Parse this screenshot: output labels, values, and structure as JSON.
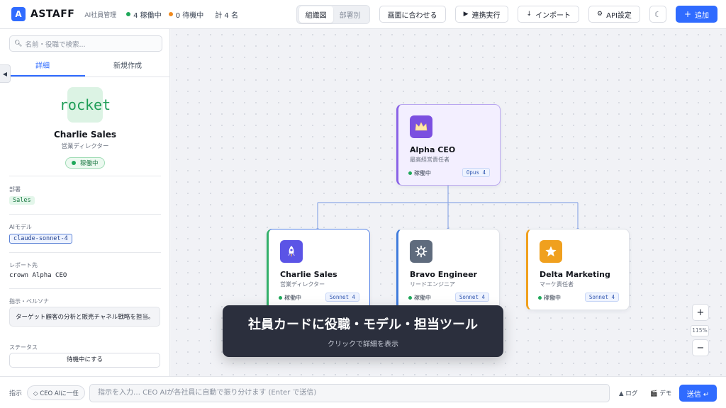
{
  "header": {
    "logo_mark": "A",
    "app_name": "ASTAFF",
    "subtitle": "AI社員管理",
    "stats": [
      {
        "label": "4 稼働中",
        "color": "#1fa85a"
      },
      {
        "label": "0 待機中",
        "color": "#f08a1e"
      },
      {
        "label": "計 4 名"
      }
    ],
    "view_tabs": [
      "組織図",
      "部署別"
    ],
    "fit_button": "画面に合わせる",
    "run_button": "連携実行",
    "import_button": "インポート",
    "api_button": "API設定",
    "add_button": "追加",
    "run_icon": "▶",
    "import_icon": "↓",
    "api_icon": "⚙",
    "theme_icon": "☾",
    "add_icon": "+"
  },
  "sidebar": {
    "collapse_icon": "◀",
    "search_placeholder": "名前・役職で検索...",
    "tabs": [
      "詳細",
      "新規作成"
    ],
    "profile": {
      "avatar_text": "rocket",
      "name": "Charlie Sales",
      "role": "営業ディレクター",
      "status": "稼働中"
    },
    "department_label": "部署",
    "department": "Sales",
    "model_label": "AIモデル",
    "model": "claude-sonnet-4",
    "report_label": "レポート先",
    "report_to": "crown Alpha CEO",
    "persona_label": "指示・ペルソナ",
    "persona": "ターゲット顧客の分析と販売チャネル戦略を担当。",
    "status_label": "ステータス",
    "status_button": "待機中にする"
  },
  "org": {
    "ceo": {
      "name": "Alpha CEO",
      "role": "最高経営責任者",
      "status": "稼働中",
      "model": "Opus 4",
      "icon_color": "#7b4fe0",
      "icon": "crown-icon"
    },
    "members": [
      {
        "name": "Charlie Sales",
        "role": "営業ディレクター",
        "status": "稼働中",
        "model": "Sonnet 4",
        "icon_color": "#5b54e6",
        "icon": "rocket-icon"
      },
      {
        "name": "Bravo Engineer",
        "role": "リードエンジニア",
        "status": "稼働中",
        "model": "Sonnet 4",
        "icon_color": "#5f6b7d",
        "icon": "gear-icon"
      },
      {
        "name": "Delta Marketing",
        "role": "マーケ責任者",
        "status": "稼働中",
        "model": "Sonnet 4",
        "icon_color": "#f0a01e",
        "icon": "star-icon"
      }
    ]
  },
  "zoom": {
    "in": "+",
    "level": "115%",
    "out": "−"
  },
  "tooltip": {
    "title": "社員カードに役職・モデル・担当ツール",
    "subtitle": "クリックで詳細を表示"
  },
  "bottom": {
    "label": "指示",
    "chip": "◇ CEO AIに一任",
    "input_placeholder": "指示を入力… CEO AIが各社員に自動で振り分けます (Enter で送信)",
    "log": "▲ ログ",
    "demo": "🎬 デモ",
    "send": "送信 ↵"
  }
}
